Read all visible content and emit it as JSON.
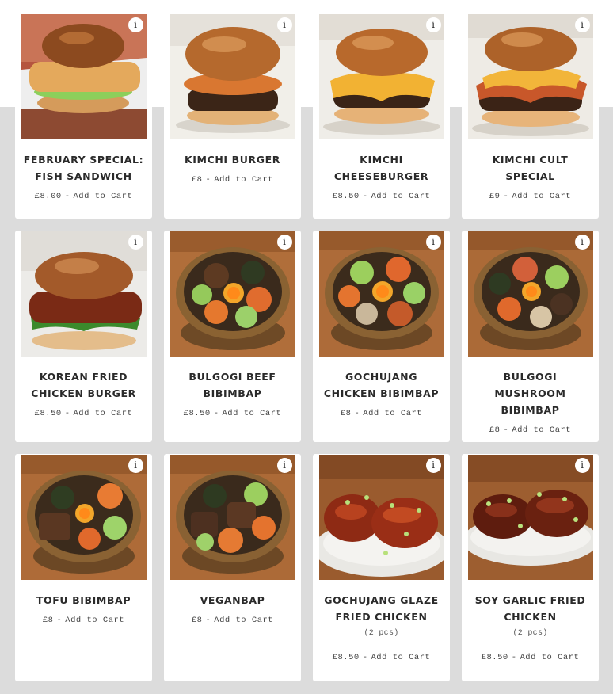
{
  "menu": {
    "items": [
      {
        "name": "February Special: Fish Sandwich",
        "price": "£8.00",
        "add_label": "Add to Cart",
        "note": "",
        "photo": "burger-fish"
      },
      {
        "name": "Kimchi Burger",
        "price": "£8",
        "add_label": "Add to Cart",
        "note": "",
        "photo": "burger-kimchi"
      },
      {
        "name": "Kimchi Cheeseburger",
        "price": "£8.50",
        "add_label": "Add to Cart",
        "note": "",
        "photo": "burger-cheese"
      },
      {
        "name": "Kimchi Cult Special",
        "price": "£9",
        "add_label": "Add to Cart",
        "note": "",
        "photo": "burger-cult"
      },
      {
        "name": "Korean Fried Chicken Burger",
        "price": "£8.50",
        "add_label": "Add to Cart",
        "note": "",
        "photo": "burger-chicken"
      },
      {
        "name": "Bulgogi Beef Bibimbap",
        "price": "£8.50",
        "add_label": "Add to Cart",
        "note": "",
        "photo": "bowl-beef"
      },
      {
        "name": "Gochujang Chicken Bibimbap",
        "price": "£8",
        "add_label": "Add to Cart",
        "note": "",
        "photo": "bowl-chicken"
      },
      {
        "name": "Bulgogi Mushroom Bibimbap",
        "price": "£8",
        "add_label": "Add to Cart",
        "note": "",
        "photo": "bowl-mushroom"
      },
      {
        "name": "Tofu Bibimbap",
        "price": "£8",
        "add_label": "Add to Cart",
        "note": "",
        "photo": "bowl-tofu"
      },
      {
        "name": "Veganbap",
        "price": "£8",
        "add_label": "Add to Cart",
        "note": "",
        "photo": "bowl-vegan"
      },
      {
        "name": "Gochujang Glaze Fried Chicken",
        "price": "£8.50",
        "add_label": "Add to Cart",
        "note": "(2 pcs)",
        "photo": "wings-gochujang"
      },
      {
        "name": "Soy Garlic Fried Chicken",
        "price": "£8.50",
        "add_label": "Add to Cart",
        "note": "(2 pcs)",
        "photo": "wings-soy"
      }
    ],
    "info_icon_glyph": "i",
    "price_separator": "-"
  },
  "colors": {
    "page_background": "#dcdcdc",
    "card_background": "#ffffff",
    "title_text": "#2a2a2a",
    "price_text": "#444444"
  }
}
